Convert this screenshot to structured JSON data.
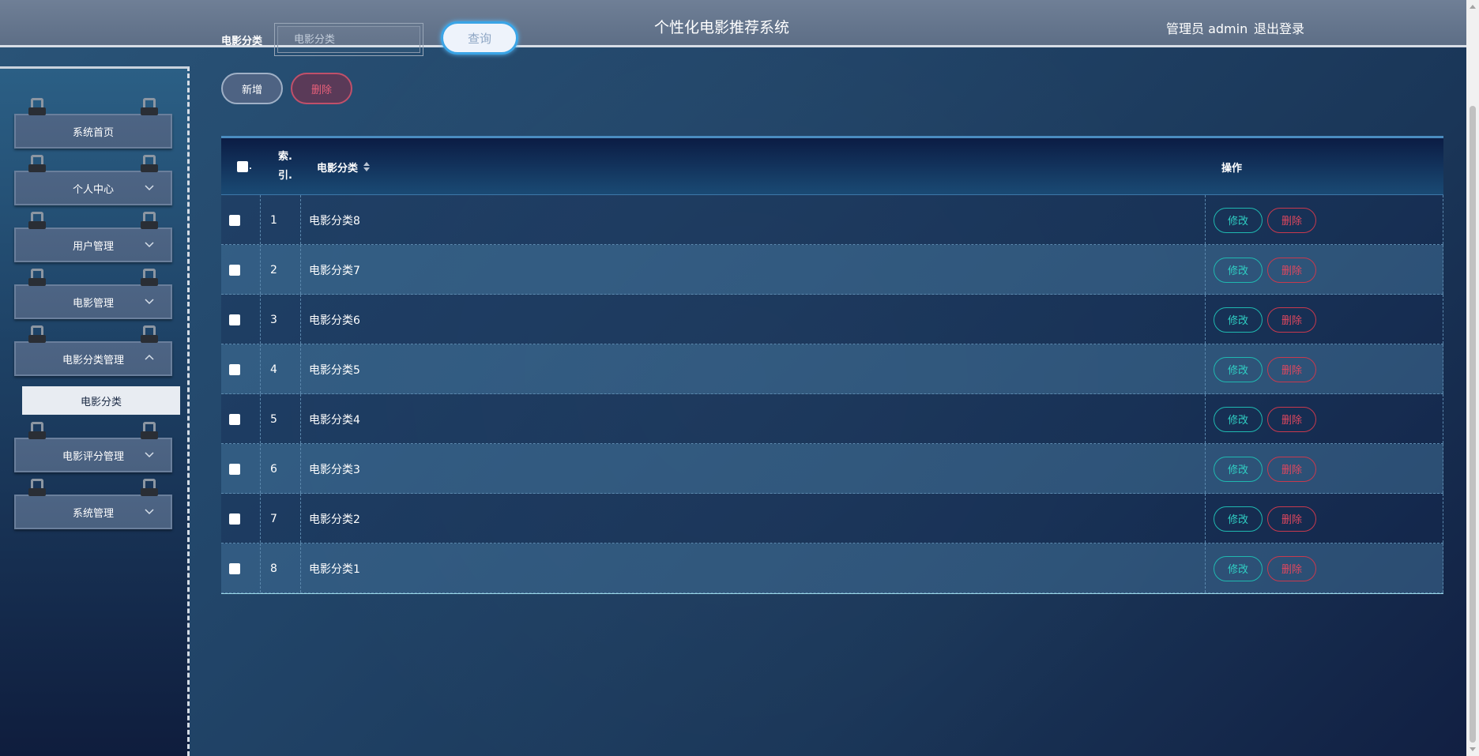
{
  "header": {
    "search_label": "电影分类",
    "search_placeholder": "电影分类",
    "query_button": "查询",
    "title": "个性化电影推荐系统",
    "admin_text": "管理员 admin",
    "logout": "退出登录"
  },
  "sidebar": {
    "items": [
      {
        "label": "系统首页",
        "has_chevron": false
      },
      {
        "label": "个人中心",
        "has_chevron": true,
        "chevron": "down"
      },
      {
        "label": "用户管理",
        "has_chevron": true,
        "chevron": "down"
      },
      {
        "label": "电影管理",
        "has_chevron": true,
        "chevron": "down"
      },
      {
        "label": "电影分类管理",
        "has_chevron": true,
        "chevron": "up"
      },
      {
        "label": "电影评分管理",
        "has_chevron": true,
        "chevron": "down"
      },
      {
        "label": "系统管理",
        "has_chevron": true,
        "chevron": "down"
      }
    ],
    "sub_item": "电影分类"
  },
  "toolbar": {
    "add_label": "新增",
    "delete_label": "删除"
  },
  "table": {
    "headers": {
      "index": "索引",
      "index_line1": "索.",
      "index_line2": "引.",
      "category": "电影分类",
      "actions": "操作"
    },
    "rows": [
      {
        "index": "1",
        "category": "电影分类8"
      },
      {
        "index": "2",
        "category": "电影分类7"
      },
      {
        "index": "3",
        "category": "电影分类6"
      },
      {
        "index": "4",
        "category": "电影分类5"
      },
      {
        "index": "5",
        "category": "电影分类4"
      },
      {
        "index": "6",
        "category": "电影分类3"
      },
      {
        "index": "7",
        "category": "电影分类2"
      },
      {
        "index": "8",
        "category": "电影分类1"
      }
    ],
    "edit_label": "修改",
    "delete_label": "删除"
  },
  "colors": {
    "edit": "#2fd0c4",
    "delete": "#e0475e",
    "query_border": "#3aa4e6"
  },
  "icons": {
    "chevron": "chevron-icon",
    "sort": "sort-icon"
  }
}
